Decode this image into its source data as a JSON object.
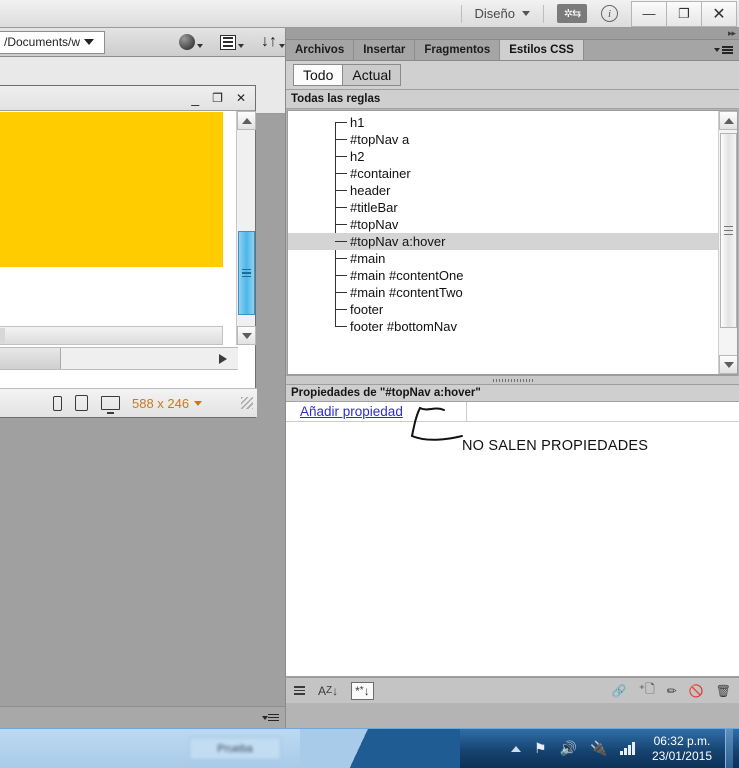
{
  "titlebar": {
    "design_menu": "Diseño",
    "gear_icon": "gear-refresh-icon",
    "info_icon": "info-icon",
    "minimize": "—",
    "maximize": "❐",
    "close": "✕"
  },
  "left_panel": {
    "path_value": "/Documents/w",
    "toolbar_icons": [
      "globe-preview-icon",
      "list-view-icon",
      "sort-icon"
    ],
    "document_window": {
      "minimize": "_",
      "maximize": "❐",
      "close": "✕",
      "canvas_color": "#FFCC00"
    },
    "statusbar": {
      "phone_icon": "phone-device-icon",
      "tablet_icon": "tablet-device-icon",
      "desktop_icon": "desktop-device-icon",
      "window_size": "588 x 246"
    }
  },
  "right_panel": {
    "tabs": [
      {
        "label": "Archivos",
        "active": false
      },
      {
        "label": "Insertar",
        "active": false
      },
      {
        "label": "Fragmentos",
        "active": false
      },
      {
        "label": "Estilos CSS",
        "active": true
      }
    ],
    "toggles": [
      {
        "label": "Todo",
        "selected": true
      },
      {
        "label": "Actual",
        "selected": false
      }
    ],
    "rules_header": "Todas las reglas",
    "rules": [
      {
        "name": "h1",
        "selected": false
      },
      {
        "name": "#topNav a",
        "selected": false
      },
      {
        "name": "h2",
        "selected": false
      },
      {
        "name": "#container",
        "selected": false
      },
      {
        "name": "header",
        "selected": false
      },
      {
        "name": "#titleBar",
        "selected": false
      },
      {
        "name": "#topNav",
        "selected": false
      },
      {
        "name": "#topNav a:hover",
        "selected": true
      },
      {
        "name": "#main",
        "selected": false
      },
      {
        "name": "#main #contentOne",
        "selected": false
      },
      {
        "name": "#main #contentTwo",
        "selected": false
      },
      {
        "name": "footer",
        "selected": false
      },
      {
        "name": "footer #bottomNav",
        "selected": false
      }
    ],
    "properties_header": "Propiedades de \"#topNav a:hover\"",
    "add_property_link": "Añadir propiedad",
    "annotation": "NO SALEN PROPIEDADES",
    "annotation_color": "#111111",
    "bottom_toolbar": {
      "left_icons": [
        "category-view-icon",
        "alphabet-sort-icon",
        "set-properties-icon"
      ],
      "right_icons": [
        "link-icon",
        "new-css-icon",
        "edit-pencil-icon",
        "disable-icon",
        "delete-trash-icon"
      ]
    }
  },
  "taskbar": {
    "tray_icons": [
      "show-hidden-icons",
      "flag-action-center-icon",
      "volume-icon",
      "battery-icon",
      "network-signal-icon"
    ],
    "time": "06:32 p.m.",
    "date": "23/01/2015"
  }
}
